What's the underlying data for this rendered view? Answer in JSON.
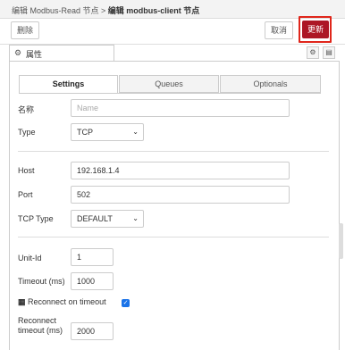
{
  "titlebar": {
    "prefix": "编辑 Modbus-Read 节点 > ",
    "current": "编辑 modbus-client 节点"
  },
  "toolbar": {
    "delete_label": "删除",
    "cancel_label": "取消",
    "update_label": "更新"
  },
  "properties_tab": {
    "label": "属性"
  },
  "subtabs": {
    "settings": "Settings",
    "queues": "Queues",
    "optionals": "Optionals"
  },
  "form": {
    "name_label": "名称",
    "name_placeholder": "Name",
    "type_label": "Type",
    "type_value": "TCP",
    "host_label": "Host",
    "host_value": "192.168.1.4",
    "port_label": "Port",
    "port_value": "502",
    "tcp_type_label": "TCP Type",
    "tcp_type_value": "DEFAULT",
    "unit_id_label": "Unit-Id",
    "unit_id_value": "1",
    "timeout_label": "Timeout (ms)",
    "timeout_value": "1000",
    "reconnect_on_timeout_label": "Reconnect on timeout",
    "reconnect_on_timeout_checked": true,
    "reconnect_timeout_label_1": "Reconnect",
    "reconnect_timeout_label_2": "timeout (ms)",
    "reconnect_timeout_value": "2000"
  },
  "colors": {
    "update_bg": "#ad1625",
    "highlight": "#e0261b",
    "checkbox": "#1a73e8"
  }
}
